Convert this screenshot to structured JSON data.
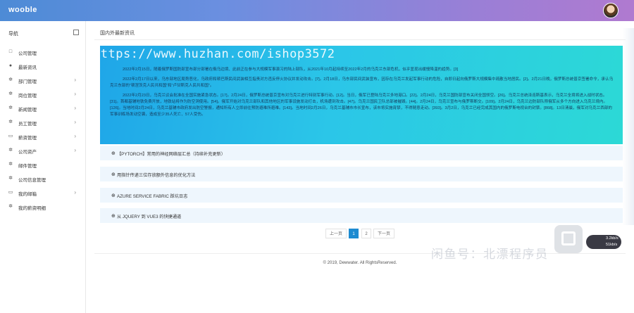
{
  "header": {
    "logo": "wooble"
  },
  "sidebar": {
    "title": "导航",
    "items": [
      {
        "label": "公司管理",
        "icon": "square-icon",
        "chevron": false
      },
      {
        "label": "最新资讯",
        "icon": "user-icon",
        "chevron": false
      },
      {
        "label": "部门管理",
        "icon": "gear-icon",
        "chevron": true
      },
      {
        "label": "岗位管理",
        "icon": "gear-icon",
        "chevron": true
      },
      {
        "label": "新闻管理",
        "icon": "gear-icon",
        "chevron": true
      },
      {
        "label": "员工管理",
        "icon": "gear-icon",
        "chevron": true
      },
      {
        "label": "薪资管理",
        "icon": "laptop-icon",
        "chevron": true
      },
      {
        "label": "公司资产",
        "icon": "gear-icon",
        "chevron": true
      },
      {
        "label": "邮件管理",
        "icon": "gear-icon",
        "chevron": false
      },
      {
        "label": "公司信息管理",
        "icon": "gear-icon",
        "chevron": false
      },
      {
        "label": "我的邮箱",
        "icon": "laptop-icon",
        "chevron": true
      },
      {
        "label": "我的薪资明细",
        "icon": "gear-icon",
        "chevron": false
      }
    ]
  },
  "main": {
    "title": "国内外最新资讯",
    "hero": {
      "watermark": "https://www.huzhan.com/ishop3572",
      "paragraphs": [
        "2022年2月15日，随着俄罗斯国防部宣布部分部署在俄乌边境、此前正在参与大规模军事演习的陆上部队，从2021年10月起持续至2022年2月的乌克兰东部危机，似乎显现出缓慢降温的趋势。[3]",
        "2022年2月17日以来，乌东部地区局势恶化，乌政府和顿巴斯民间武装相互指责对方违反停火协议并发动攻击。[7]。2月18日，乌东部民间武装宣布，因存在乌克兰发起军事行动的危险，自即日起向俄罗斯大规模集中疏散当地居民。[2]。2月21日晚，俄罗斯总统普京签署命令，承认乌克兰东部的“顿涅茨克人民共和国”和“卢甘斯克人民共和国”。",
        "2022年2月23日，乌克兰议会批准在全国实施紧急状态。[17]。2月24日，俄罗斯总统普京宣布对乌克兰进行特别军事行动。[12]。当日，俄军已登陆乌克兰多地港口。[22]。2月24日，乌克兰国防部宣布关闭全国领空。[26]。乌克兰总统泽连斯基表示，乌克兰全境将进入战时状态。[31]。首都基辅地铁免费开放，地铁站将作为防空洞使用。[54]。俄军开始对乌克兰部队和其他地区的军事设施发动打击，机场遭到攻击。[47]。乌克兰国民卫队总部被摧毁。[44]。2月24日，乌克兰宣布与俄罗斯断交。[109]。2月24日，乌克兰边防部队称俄军从多个方向进入乌克兰境内。[126]。当地时间2月24日，乌克兰基辅市政府发出防空警报，通知所有人立即前往预防避难所避难。[143]。当地时间2月26日，乌克兰基辅市市长宣布，该市将实施宵禁，不得随意走动。[393]。3月2日，乌克兰已经完成其国内的俄罗斯电视台的封禁。[868]。13日清晨，俄军对乌克兰西部的军事训练场发动空袭，造成至少35人死亡、57人受伤。"
      ]
    },
    "accordion": [
      {
        "label": "【PYTORCH】常用的神经网络层汇总（持续补充更新）"
      },
      {
        "label": "用指针传递三位存放额外信息的优化方法"
      },
      {
        "label": "AZURE SERVICE FABRIC 踩坑日志"
      },
      {
        "label": "从 JQUERY 到 VUE3 的快捷通道"
      }
    ],
    "pager": {
      "prev": "上一页",
      "pages": [
        "1",
        "2"
      ],
      "current": "1",
      "next": "下一页"
    },
    "footer": "© 2019, Dewwater. All RightsReserved."
  },
  "overlay": {
    "brand_watermark": "闲鱼号：北漂程序员",
    "pill_line1": "3.2kb/s",
    "pill_line2": "51kb/s"
  }
}
